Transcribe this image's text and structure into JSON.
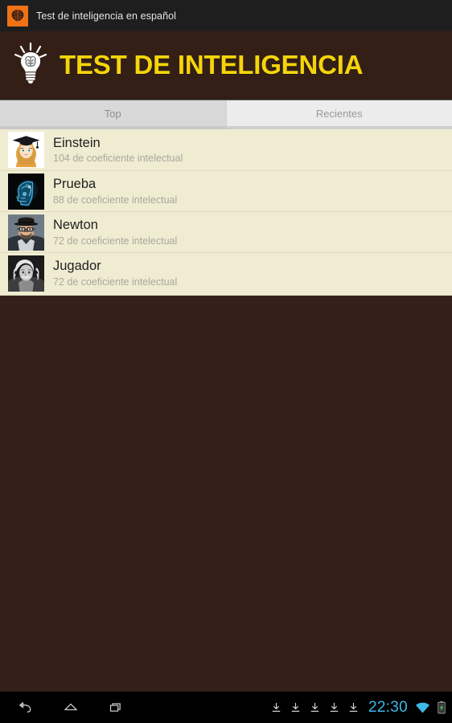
{
  "system_bar": {
    "app_icon": "brain-icon",
    "title": "Test de inteligencia en español"
  },
  "app_header": {
    "logo_icon": "lightbulb-brain-icon",
    "title": "TEST DE INTELIGENCIA",
    "title_color": "#f5d40a",
    "background_color": "#331f16"
  },
  "tabs": [
    {
      "label": "Top",
      "selected": true
    },
    {
      "label": "Recientes",
      "selected": false
    }
  ],
  "scores": {
    "background_color": "#efecd2",
    "items": [
      {
        "avatar": "graduate-girl-avatar",
        "name": "Einstein",
        "subtitle": "104 de coeficiente intelectual"
      },
      {
        "avatar": "xray-brain-avatar",
        "name": "Prueba",
        "subtitle": "88 de coeficiente intelectual"
      },
      {
        "avatar": "man-hat-glasses-avatar",
        "name": "Newton",
        "subtitle": "72 de coeficiente intelectual"
      },
      {
        "avatar": "einstein-photo-avatar",
        "name": "Jugador",
        "subtitle": "72 de coeficiente intelectual"
      }
    ]
  },
  "nav_bar": {
    "back_icon": "back-arrow-icon",
    "home_icon": "home-icon",
    "recents_icon": "recent-apps-icon",
    "download_icons": [
      "download-icon",
      "download-icon",
      "download-icon",
      "download-icon",
      "download-icon"
    ],
    "clock": "22:30",
    "clock_color": "#3cb9e8",
    "wifi_icon": "wifi-icon",
    "battery_icon": "battery-charging-icon"
  }
}
